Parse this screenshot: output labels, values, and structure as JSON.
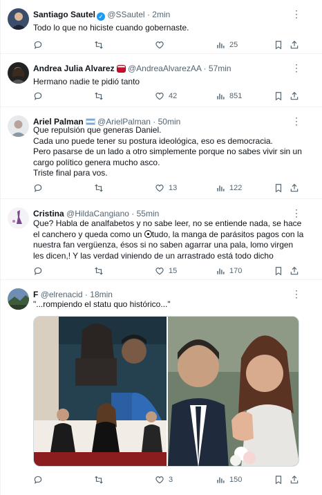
{
  "tweets": [
    {
      "name": "Santiago Sautel",
      "handle": "@SSautel",
      "time": "2min",
      "text": "Todo lo que no hiciste cuando gobernaste.",
      "replies": "",
      "retweets": "",
      "likes": "",
      "views": "25"
    },
    {
      "name": "Andrea Julia Alvarez",
      "handle": "@AndreaAlvarezAA",
      "time": "57min",
      "text": "Hermano nadie te pidió tanto",
      "replies": "",
      "retweets": "",
      "likes": "42",
      "views": "851"
    },
    {
      "name": "Ariel Palman",
      "handle": "@ArielPalman",
      "time": "50min",
      "text": "Que repulsión que generas Daniel.\nCada uno puede tener su postura ideológica, eso es democracia.\nPero pasarse de un lado a otro simplemente porque no sabes vivir sin un cargo político genera mucho asco.\nTriste final para vos.",
      "replies": "",
      "retweets": "",
      "likes": "13",
      "views": "122"
    },
    {
      "name": "Cristina",
      "handle": "@HildaCangiano",
      "time": "55min",
      "text_before_ball": "Que? Habla de analfabetos y no sabe leer, no se entiende nada, se hace el canchero y queda como un ",
      "text_after_ball": "tudo, la manga de parásitos pagos con la nuestra fan vergüenza, ésos si no saben agarrar una pala, lomo virgen les dicen,! Y las verdad viniendo de un arrastrado está todo dicho",
      "replies": "",
      "retweets": "",
      "likes": "15",
      "views": "170"
    },
    {
      "name": "F",
      "handle": "@elrenacid",
      "time": "18min",
      "text": "\"...rompiendo el statu quo histórico...\"",
      "replies": "",
      "retweets": "",
      "likes": "3",
      "views": "150"
    }
  ],
  "separator": "·",
  "verified_mark": "✓",
  "more_glyph": "⋮",
  "colors": {
    "accent": "#1d9bf0",
    "text": "#0f1419",
    "muted": "#536471",
    "divider": "#eff3f4"
  },
  "icons": [
    "reply-icon",
    "retweet-icon",
    "like-icon",
    "views-icon",
    "bookmark-icon",
    "share-icon",
    "more-icon",
    "verified-badge-icon",
    "argentina-flag-icon",
    "drum-emoji-icon",
    "soccer-ball-emoji-icon"
  ]
}
